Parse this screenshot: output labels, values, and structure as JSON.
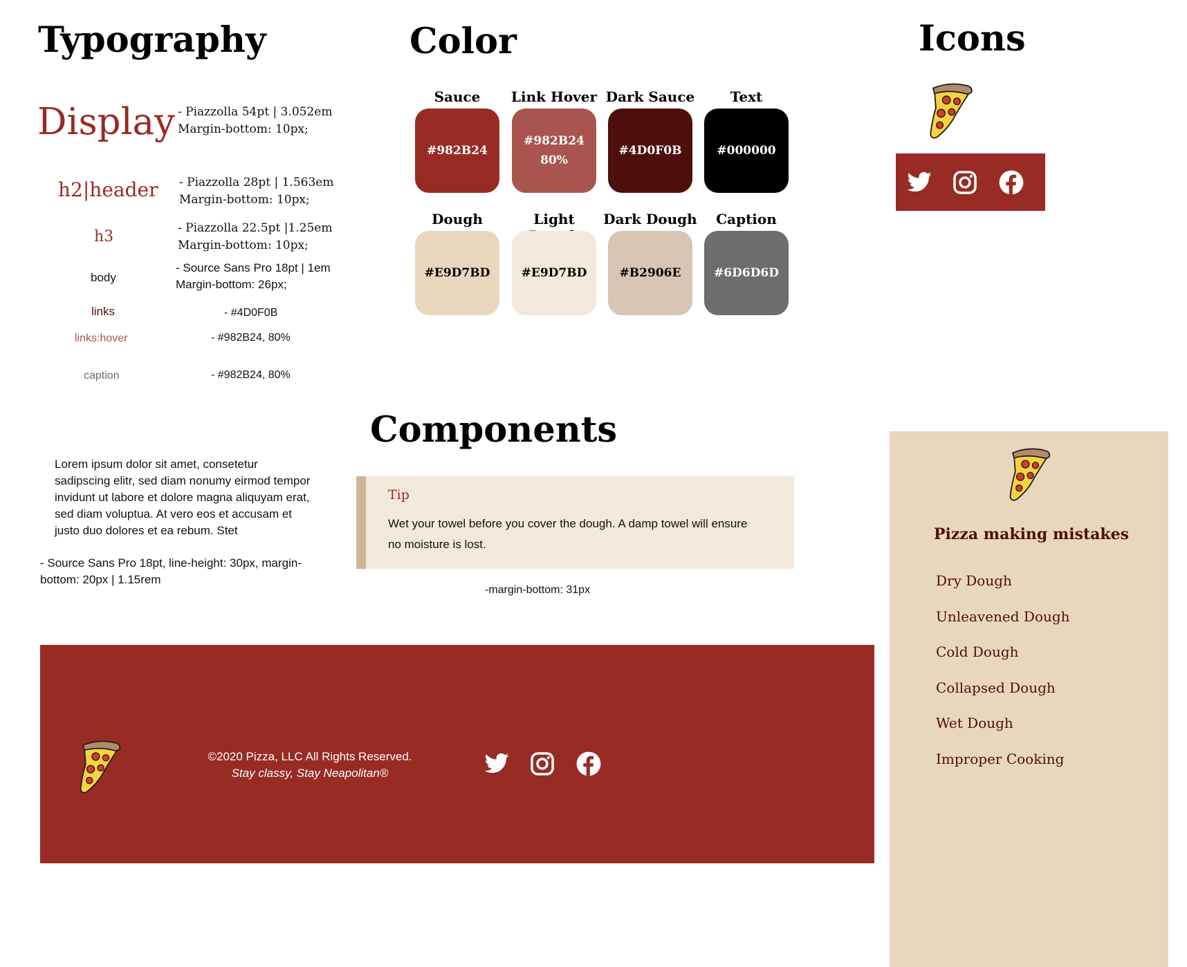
{
  "sections": {
    "typography": "Typography",
    "color": "Color",
    "icons": "Icons",
    "components": "Components"
  },
  "typography": {
    "display": {
      "sample": "Display",
      "spec1": "- Piazzolla 54pt | 3.052em",
      "spec2": "Margin-bottom: 10px;"
    },
    "h2": {
      "sample": "h2|header",
      "spec1": "- Piazzolla 28pt | 1.563em",
      "spec2": "Margin-bottom: 10px;"
    },
    "h3": {
      "sample": "h3",
      "spec1": "- Piazzolla 22.5pt |1.25em",
      "spec2": "Margin-bottom: 10px;"
    },
    "body": {
      "sample": "body",
      "spec1": "- Source Sans Pro 18pt | 1em",
      "spec2": "Margin-bottom: 26px;"
    },
    "links": {
      "sample": "links",
      "spec1": "- #4D0F0B"
    },
    "links_hover": {
      "sample": "links:hover",
      "spec1": "- #982B24, 80%"
    },
    "caption": {
      "sample": "caption",
      "spec1": "- #982B24, 80%"
    },
    "lorem": "Lorem ipsum dolor sit amet, consetetur sadipscing elitr, sed diam nonumy eirmod tempor invidunt ut labore et dolore magna aliquyam erat, sed diam voluptua. At vero eos et accusam et justo duo dolores et ea rebum. Stet",
    "body_spec": "- Source Sans Pro 18pt, line-height: 30px, margin-bottom: 20px | 1.15rem"
  },
  "colors": [
    {
      "label": "Sauce",
      "code": "#982B24",
      "bg": "#982B24",
      "fg": "#ffffff"
    },
    {
      "label": "Link  Hover",
      "code": "#982B24\n80%",
      "bg": "#A9544E",
      "fg": "#ffffff"
    },
    {
      "label": "Dark Sauce",
      "code": "#4D0F0B",
      "bg": "#4D0F0B",
      "fg": "#ffffff"
    },
    {
      "label": "Text",
      "code": "#000000",
      "bg": "#000000",
      "fg": "#ffffff"
    },
    {
      "label": "Dough",
      "code": "#E9D7BD",
      "bg": "#E9D7BD",
      "fg": "#000000"
    },
    {
      "label": "Light Dough",
      "code": "#E9D7BD",
      "bg": "#F3E8DC",
      "fg": "#000000"
    },
    {
      "label": "Dark Dough",
      "code": "#B2906E",
      "bg": "#D8C5B4",
      "fg": "#000000"
    },
    {
      "label": "Caption",
      "code": "#6D6D6D",
      "bg": "#6D6D6D",
      "fg": "#ffffff"
    }
  ],
  "tip": {
    "title": "Tip",
    "text": "Wet your towel before you cover the dough. A damp towel will ensure no moisture is lost.",
    "note": "-margin-bottom: 31px"
  },
  "footer": {
    "copyright": "©2020 Pizza, LLC All Rights Reserved.",
    "tagline": "Stay classy, Stay Neapolitan®"
  },
  "sidebar": {
    "title": "Pizza making mistakes",
    "items": [
      "Dry Dough",
      "Unleavened Dough",
      "Cold Dough",
      "Collapsed Dough",
      "Wet Dough",
      "Improper Cooking"
    ]
  },
  "icons": [
    "pizza-icon",
    "twitter-icon",
    "instagram-icon",
    "facebook-icon"
  ],
  "brand_colors": {
    "sauce": "#982B24",
    "dark_sauce": "#4D0F0B",
    "dough": "#E9D7BD",
    "light_dough": "#F3E8DC"
  }
}
